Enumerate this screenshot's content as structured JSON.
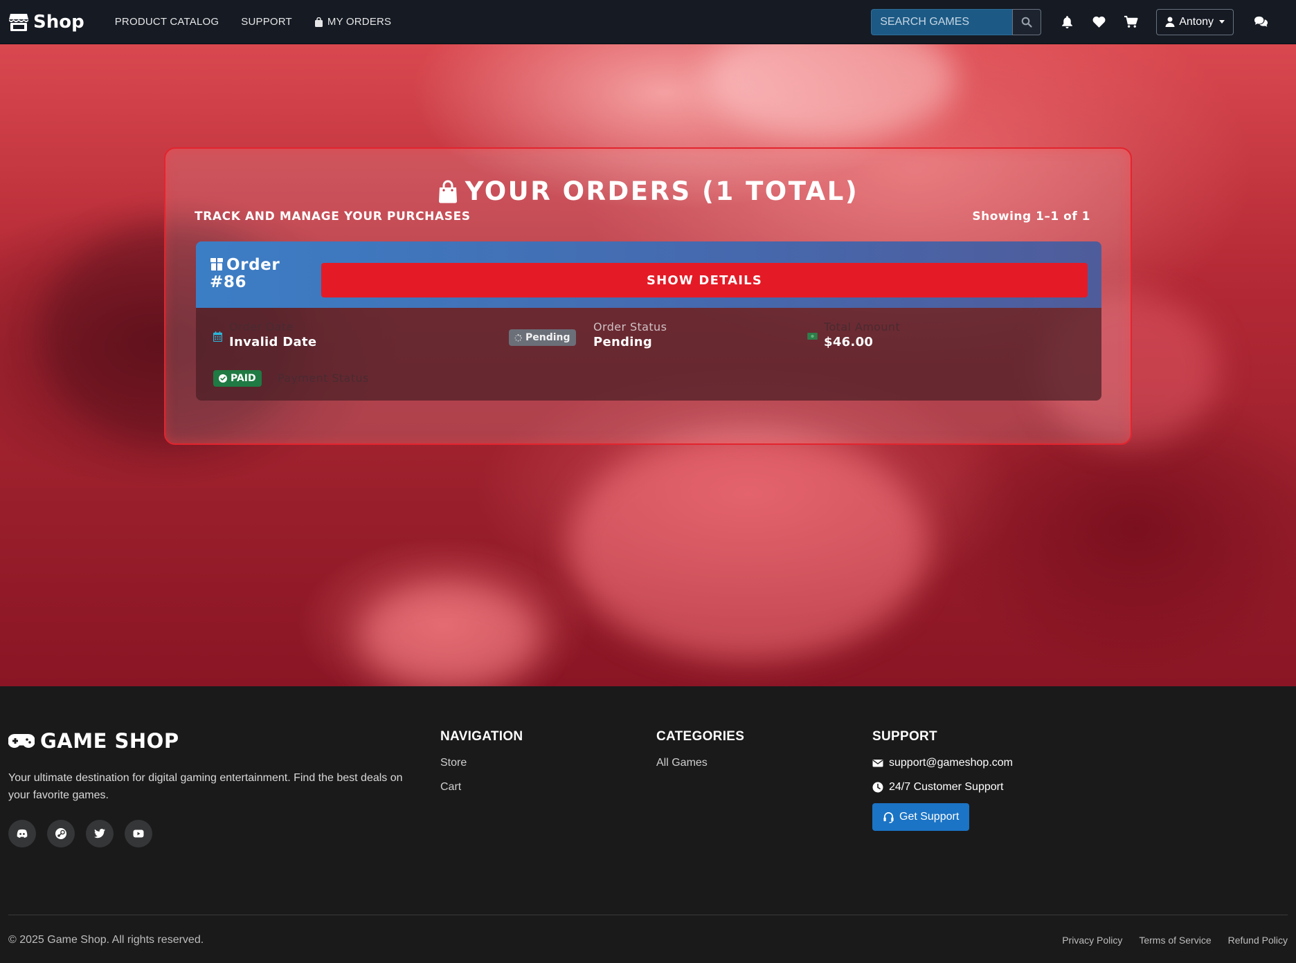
{
  "navbar": {
    "brand": "Shop",
    "links": [
      "PRODUCT CATALOG",
      "SUPPORT",
      "MY ORDERS"
    ],
    "search_placeholder": "SEARCH GAMES",
    "user_name": "Antony"
  },
  "orders": {
    "title": "YOUR ORDERS (1 TOTAL)",
    "subtitle": "TRACK AND MANAGE YOUR PURCHASES",
    "showing": "Showing 1–1 of 1",
    "items": [
      {
        "order_number": "Order",
        "order_id": "#86",
        "show_details_label": "SHOW DETAILS",
        "order_date_label": "Order Date",
        "order_date_value": "Invalid Date",
        "status_badge": "Pending",
        "order_status_label": "Order Status",
        "order_status_value": "Pending",
        "total_label": "Total Amount",
        "total_value": "$46.00",
        "payment_badge": "PAID",
        "payment_label": "Payment Status"
      }
    ]
  },
  "footer": {
    "brand": "GAME SHOP",
    "description": "Your ultimate destination for digital gaming entertainment. Find the best deals on your favorite games.",
    "social_icons": [
      "discord-icon",
      "steam-icon",
      "twitter-icon",
      "youtube-icon"
    ],
    "navigation": {
      "title": "NAVIGATION",
      "links": [
        "Store",
        "Cart"
      ]
    },
    "categories": {
      "title": "CATEGORIES",
      "links": [
        "All Games"
      ]
    },
    "support": {
      "title": "SUPPORT",
      "email": "support@gameshop.com",
      "hours": "24/7 Customer Support",
      "button": "Get Support"
    },
    "copyright": "© 2025 Game Shop. All rights reserved.",
    "legal_links": [
      "Privacy Policy",
      "Terms of Service",
      "Refund Policy"
    ]
  },
  "colors": {
    "accent_red": "#e41b26",
    "order_header_blue": "#3c7ec5",
    "support_button": "#1b74c5",
    "paid_green": "#1f7a43",
    "pending_gray": "#6b6f78"
  }
}
